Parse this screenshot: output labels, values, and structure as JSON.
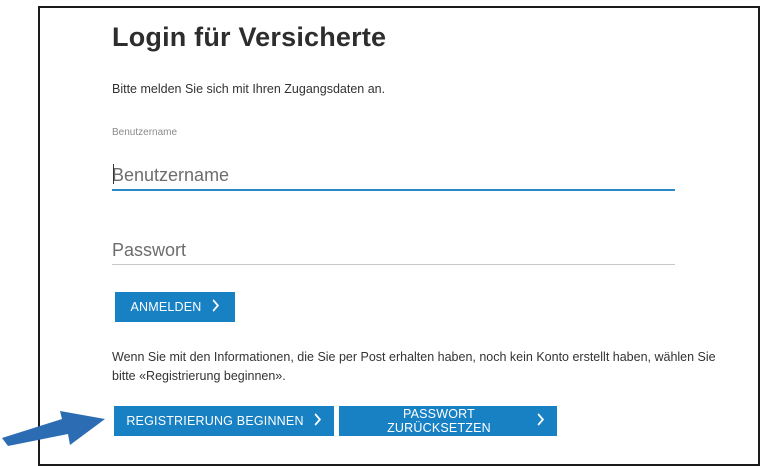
{
  "page": {
    "title": "Login für Versicherte",
    "intro": "Bitte melden Sie sich mit Ihren Zugangsdaten an."
  },
  "form": {
    "username_label": "Benutzername",
    "username_placeholder": "Benutzername",
    "username_value": "",
    "password_placeholder": "Passwort",
    "password_value": "",
    "login_label": "ANMELDEN"
  },
  "info": {
    "text": "Wenn Sie mit den Informationen, die Sie per Post erhalten haben, noch kein Konto erstellt haben, wählen Sie bitte «Registrierung beginnen»."
  },
  "actions": {
    "register_label": "REGISTRIERUNG BEGINNEN",
    "reset_label": "PASSWORT ZURÜCKSETZEN"
  },
  "icons": {
    "chevron": "›",
    "annotation_arrow": "arrow-pointing-right"
  },
  "colors": {
    "accent": "#1781c4",
    "focus_underline": "#2a89c9",
    "arrow": "#2b6cb3"
  }
}
